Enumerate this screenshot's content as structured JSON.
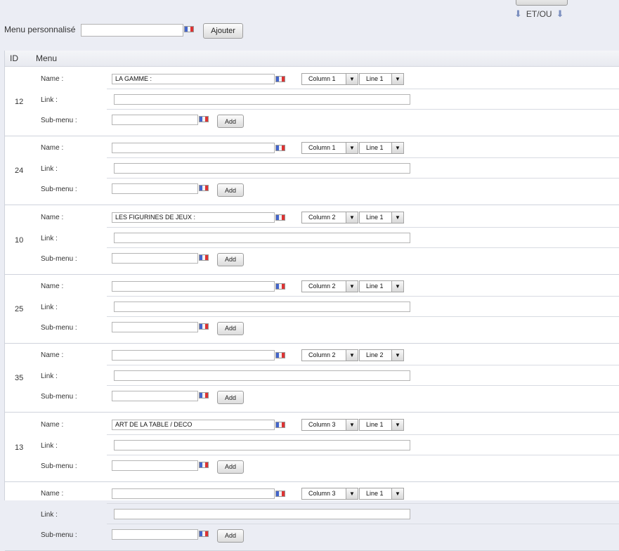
{
  "filter": {
    "connector_label": "ET/OU",
    "arrow_glyph": "⬇"
  },
  "custom_menu": {
    "label": "Menu personnalisé",
    "input_value": "",
    "add_button": "Ajouter"
  },
  "table": {
    "headers": {
      "id": "ID",
      "menu": "Menu"
    },
    "labels": {
      "name": "Name :",
      "link": "Link :",
      "submenu": "Sub-menu :",
      "add": "Add"
    },
    "rows": [
      {
        "id": "12",
        "name": "LA GAMME :",
        "column": "Column 1",
        "line": "Line 1",
        "link": "",
        "submenu": ""
      },
      {
        "id": "24",
        "name": "",
        "column": "Column 1",
        "line": "Line 1",
        "link": "",
        "submenu": ""
      },
      {
        "id": "10",
        "name": "LES FIGURINES DE JEUX :",
        "column": "Column 2",
        "line": "Line 1",
        "link": "",
        "submenu": ""
      },
      {
        "id": "25",
        "name": "",
        "column": "Column 2",
        "line": "Line 1",
        "link": "",
        "submenu": ""
      },
      {
        "id": "35",
        "name": "",
        "column": "Column 2",
        "line": "Line 2",
        "link": "",
        "submenu": ""
      },
      {
        "id": "13",
        "name": "ART DE LA TABLE / DECO",
        "column": "Column 3",
        "line": "Line 1",
        "link": "",
        "submenu": ""
      },
      {
        "id": "",
        "name": "",
        "column": "Column 3",
        "line": "Line 1",
        "link": "",
        "submenu": ""
      }
    ]
  },
  "icons": {
    "flag": "language-flag-icon",
    "dropdown": "▼"
  }
}
